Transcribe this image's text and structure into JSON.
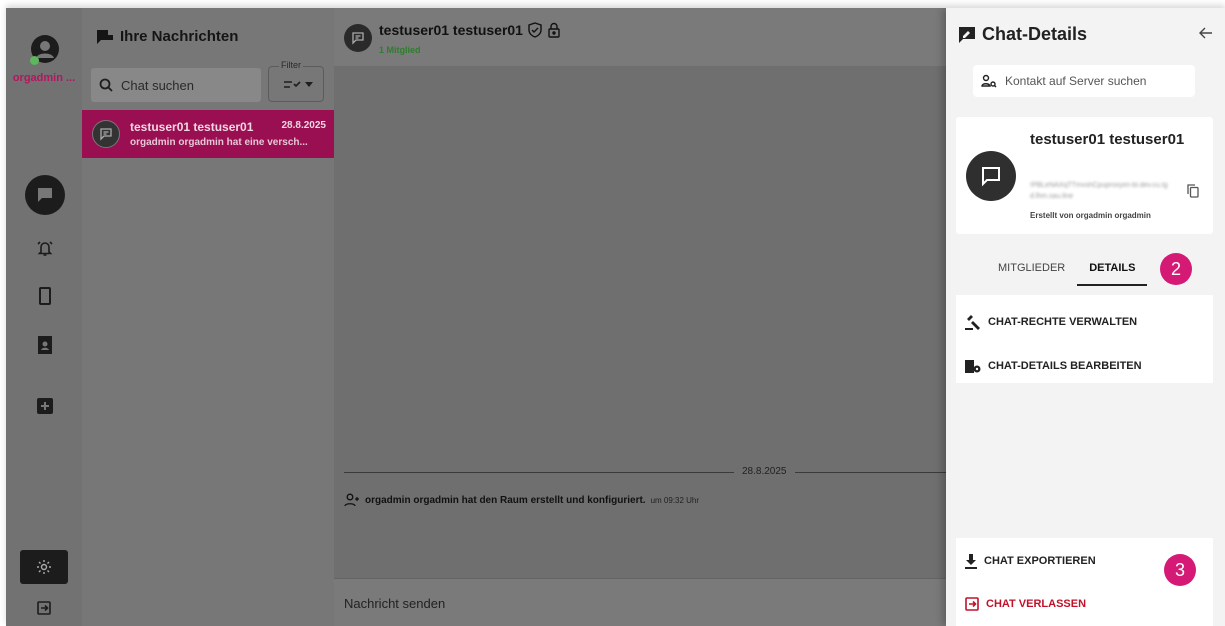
{
  "rail": {
    "username": "orgadmin ...",
    "icons": [
      "account-icon",
      "chat-icon",
      "bell-icon",
      "phone-icon",
      "contacts-icon",
      "add-icon",
      "settings-icon",
      "logout-icon"
    ]
  },
  "chatlist": {
    "title": "Ihre Nachrichten",
    "search_placeholder": "Chat suchen",
    "filter_label": "Filter",
    "items": [
      {
        "name": "testuser01 testuser01",
        "date": "28.8.2025",
        "preview": "orgadmin orgadmin hat eine versch..."
      }
    ]
  },
  "main": {
    "title": "testuser01 testuser01",
    "subtitle": "1 Mitglied",
    "date_separator": "28.8.2025",
    "system_message": "orgadmin orgadmin hat den Raum erstellt und konfiguriert.",
    "system_time": "um 09:32 Uhr",
    "composer_placeholder": "Nachricht senden"
  },
  "panel": {
    "title": "Chat-Details",
    "search_placeholder": "Kontakt auf Server suchen",
    "chat_name": "testuser01 testuser01",
    "room_id": "!PBLeNAXqTTmvshCpuproxyim-bl.dev.cu.tgd.lhm.sau.line",
    "creator": "Erstellt von orgadmin orgadmin",
    "tabs": [
      "MITGLIEDER",
      "DETAILS"
    ],
    "active_tab": "DETAILS",
    "actions": [
      "CHAT-RECHTE VERWALTEN",
      "CHAT-DETAILS BEARBEITEN"
    ],
    "export_label": "CHAT EXPORTIEREN",
    "leave_label": "CHAT VERLASSEN",
    "callouts": [
      "2",
      "3"
    ]
  },
  "colors": {
    "accent": "#9a0f52",
    "callout": "#d41a75",
    "danger": "#c0102a",
    "online": "#5cb85c"
  }
}
